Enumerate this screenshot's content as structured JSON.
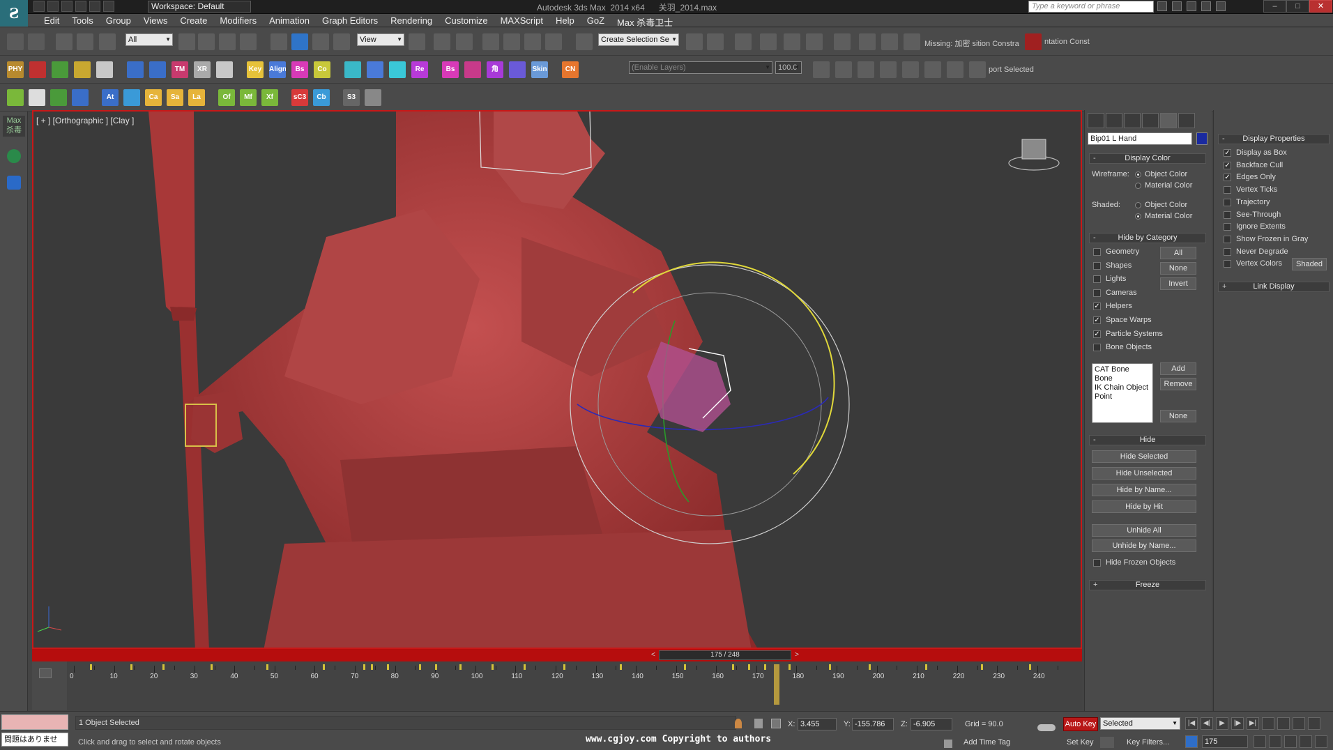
{
  "titlebar": {
    "workspace": "Workspace: Default",
    "title": "Autodesk 3ds Max  2014 x64      关羽_2014.max",
    "search_placeholder": "Type a keyword or phrase"
  },
  "menu": [
    "Edit",
    "Tools",
    "Group",
    "Views",
    "Create",
    "Modifiers",
    "Animation",
    "Graph Editors",
    "Rendering",
    "Customize",
    "MAXScript",
    "Help",
    "GoZ",
    "Max 杀毒卫士"
  ],
  "toolbar1": {
    "selection_filter": "All",
    "ref_coord": "View",
    "named_selection": "Create Selection Se",
    "missing_text": "Missing: 加密 sition Constra",
    "constraint_text": "ntation Const"
  },
  "toolbar2": {
    "icons": [
      {
        "label": "PHY",
        "color": "#b88a2e"
      },
      {
        "label": "",
        "color": "#c03030"
      },
      {
        "label": "",
        "color": "#4a9a3a"
      },
      {
        "label": "",
        "color": "#c9a830"
      },
      {
        "label": "",
        "color": "#c8c8c8"
      },
      {
        "label": "",
        "color": "#3a6ec8"
      },
      {
        "label": "",
        "color": "#3a6ec8"
      },
      {
        "label": "TM",
        "color": "#c83a6e"
      },
      {
        "label": "XR",
        "color": "#aaaaaa"
      },
      {
        "label": "",
        "color": "#c8c8c8"
      },
      {
        "label": "Key",
        "color": "#e6c23a"
      },
      {
        "label": "Align",
        "color": "#4a7ad8"
      },
      {
        "label": "Bs",
        "color": "#d83ab8"
      },
      {
        "label": "Co",
        "color": "#c8c83a"
      },
      {
        "label": "",
        "color": "#3ab8c8"
      },
      {
        "label": "",
        "color": "#4a7ad8"
      },
      {
        "label": "",
        "color": "#3ac8d8"
      },
      {
        "label": "Re",
        "color": "#b83ad8"
      },
      {
        "label": "Bs",
        "color": "#d83ab8"
      },
      {
        "label": "",
        "color": "#c83a8a"
      },
      {
        "label": "角",
        "color": "#a83ad8"
      },
      {
        "label": "",
        "color": "#6a5ad8"
      },
      {
        "label": "Skin",
        "color": "#6a9ad8"
      },
      {
        "label": "CN",
        "color": "#e6762e"
      }
    ],
    "layer_field": "(Enable Layers)",
    "value_field": "100.0",
    "port_selected": "port Selected"
  },
  "toolbar3": {
    "icons": [
      {
        "label": "",
        "color": "#7ab83a"
      },
      {
        "label": "",
        "color": "#dddddd"
      },
      {
        "label": "",
        "color": "#4a9a3a"
      },
      {
        "label": "",
        "color": "#3a6ec8"
      },
      {
        "label": "At",
        "color": "#3a6ec8"
      },
      {
        "label": "",
        "color": "#3a9ad8"
      },
      {
        "label": "Ca",
        "color": "#e6b43a"
      },
      {
        "label": "Sa",
        "color": "#e6b43a"
      },
      {
        "label": "La",
        "color": "#e6b43a"
      },
      {
        "label": "Of",
        "color": "#7ab83a"
      },
      {
        "label": "Mf",
        "color": "#7ab83a"
      },
      {
        "label": "Xf",
        "color": "#7ab83a"
      },
      {
        "label": "sC3",
        "color": "#d83a3a"
      },
      {
        "label": "Cb",
        "color": "#3a9ad8"
      },
      {
        "label": "S3",
        "color": "#666666"
      },
      {
        "label": "",
        "color": "#888888"
      }
    ]
  },
  "viewport": {
    "label": "[ + ] [Orthographic ] [Clay ]",
    "accent_color": "#c81818"
  },
  "timeline": {
    "slider_label": "175 / 248",
    "current_frame": 175,
    "total_frames": 248,
    "ticks": [
      0,
      10,
      20,
      30,
      40,
      50,
      60,
      70,
      80,
      90,
      100,
      110,
      120,
      130,
      140,
      150,
      160,
      170,
      180,
      190,
      200,
      210,
      220,
      230,
      240
    ],
    "keys": [
      4,
      14,
      22,
      34,
      48,
      62,
      72,
      74,
      78,
      86,
      90,
      96,
      104,
      112,
      122,
      136,
      152,
      164,
      168,
      172,
      178,
      188,
      198,
      212,
      226,
      238
    ]
  },
  "command_panel": {
    "object_name": "Bip01 L Hand",
    "object_color": "#1a2aa0",
    "display_color": {
      "title": "Display Color",
      "wireframe_label": "Wireframe:",
      "shaded_label": "Shaded:",
      "opt_object": "Object Color",
      "opt_material": "Material Color"
    },
    "hide_by_category": {
      "title": "Hide by Category",
      "items": [
        {
          "label": "Geometry",
          "checked": false
        },
        {
          "label": "Shapes",
          "checked": false
        },
        {
          "label": "Lights",
          "checked": false
        },
        {
          "label": "Cameras",
          "checked": false
        },
        {
          "label": "Helpers",
          "checked": true
        },
        {
          "label": "Space Warps",
          "checked": true
        },
        {
          "label": "Particle Systems",
          "checked": true
        },
        {
          "label": "Bone Objects",
          "checked": false
        }
      ],
      "btn_all": "All",
      "btn_none": "None",
      "btn_invert": "Invert",
      "list": [
        "CAT Bone",
        "Bone",
        "IK Chain Object",
        "Point"
      ],
      "btn_add": "Add",
      "btn_remove": "Remove",
      "btn_none2": "None"
    },
    "hide": {
      "title": "Hide",
      "buttons": [
        "Hide Selected",
        "Hide Unselected",
        "Hide by Name...",
        "Hide by Hit",
        "Unhide All",
        "Unhide by Name..."
      ],
      "frozen_label": "Hide Frozen Objects"
    },
    "freeze_title": "Freeze"
  },
  "display_properties": {
    "title": "Display Properties",
    "items": [
      {
        "label": "Display as Box",
        "checked": true
      },
      {
        "label": "Backface Cull",
        "checked": true
      },
      {
        "label": "Edges Only",
        "checked": true
      },
      {
        "label": "Vertex Ticks",
        "checked": false
      },
      {
        "label": "Trajectory",
        "checked": false
      },
      {
        "label": "See-Through",
        "checked": false
      },
      {
        "label": "Ignore Extents",
        "checked": false
      },
      {
        "label": "Show Frozen in Gray",
        "checked": false
      },
      {
        "label": "Never Degrade",
        "checked": false
      },
      {
        "label": "Vertex Colors",
        "checked": false
      }
    ],
    "shaded_btn": "Shaded",
    "link_display": "Link Display"
  },
  "status": {
    "maxscript_text": "問題はありませ",
    "selection_status": "1 Object Selected",
    "prompt": "Click and drag to select and rotate objects",
    "x_label": "X:",
    "x_value": "3.455",
    "y_label": "Y:",
    "y_value": "-155.786",
    "z_label": "Z:",
    "z_value": "-6.905",
    "grid": "Grid = 90.0",
    "add_time_tag": "Add Time Tag",
    "auto_key": "Auto Key",
    "selected_dropdown": "Selected",
    "set_key": "Set Key",
    "key_filters": "Key Filters...",
    "frame_field": "175",
    "watermark": "www.cgjoy.com Copyright to authors"
  }
}
